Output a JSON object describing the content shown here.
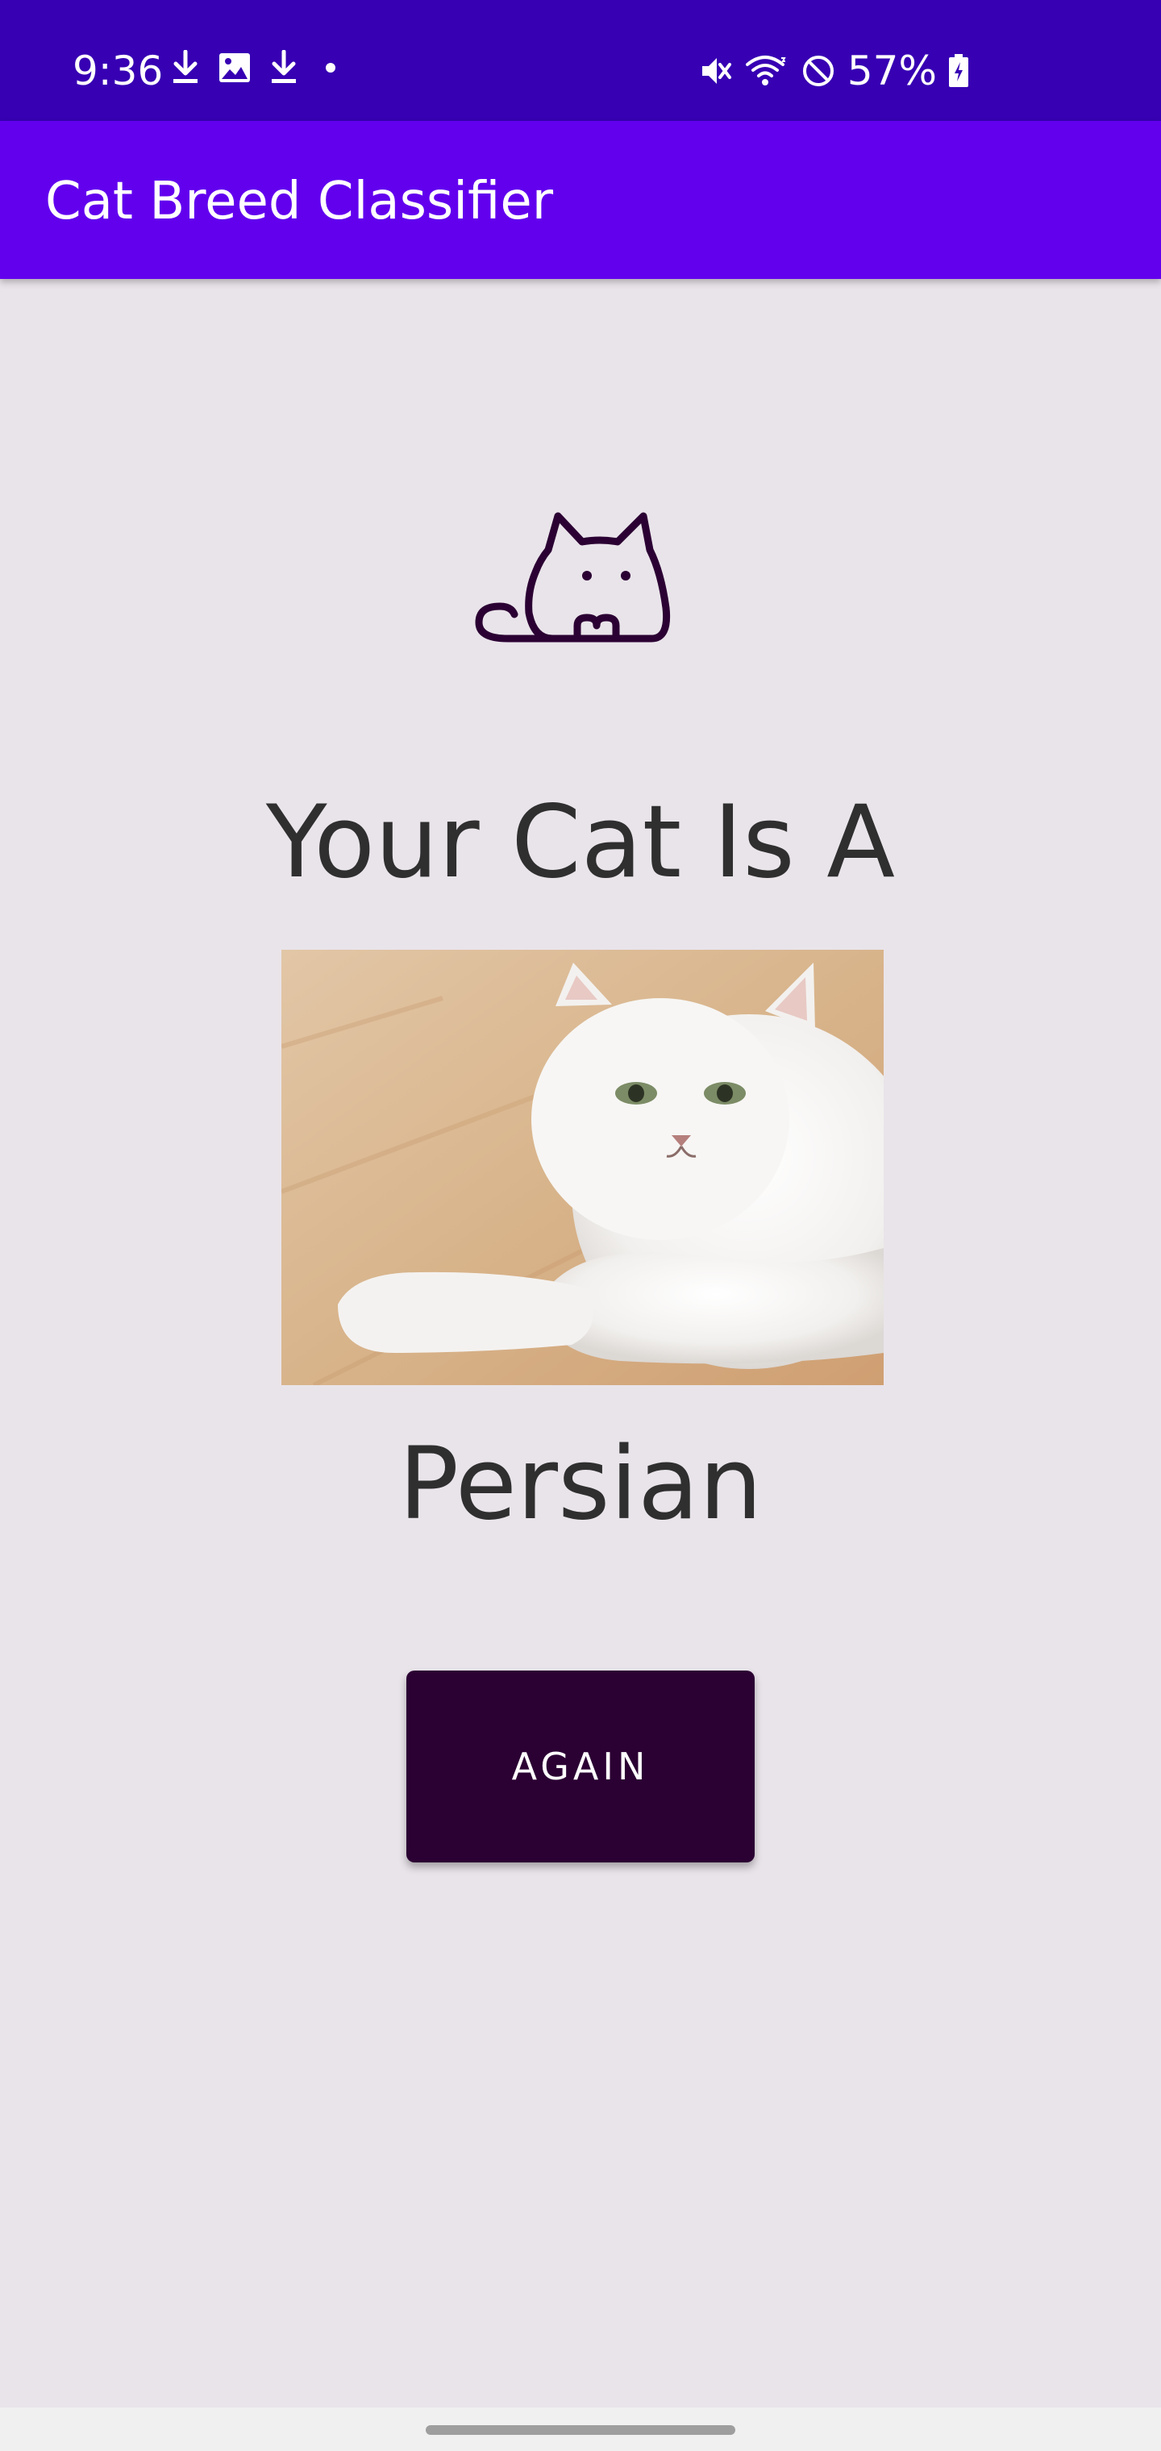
{
  "status_bar": {
    "time": "9:36",
    "battery": "57%",
    "left_icons": [
      "download-icon",
      "image-icon",
      "download-icon",
      "dot-icon"
    ],
    "right_icons": [
      "mute-icon",
      "wifi-icon",
      "do-not-disturb-icon",
      "battery-charging-icon"
    ]
  },
  "app_bar": {
    "title": "Cat Breed Classifier"
  },
  "main": {
    "logo_icon": "cat-outline-icon",
    "headline": "Your Cat Is A",
    "breed": "Persian",
    "again_button": "AGAIN"
  },
  "colors": {
    "status_bar": "#3700b3",
    "app_bar": "#6200ee",
    "background": "#e9e4ea",
    "button": "#2b0033",
    "text": "#2f2f2f"
  }
}
